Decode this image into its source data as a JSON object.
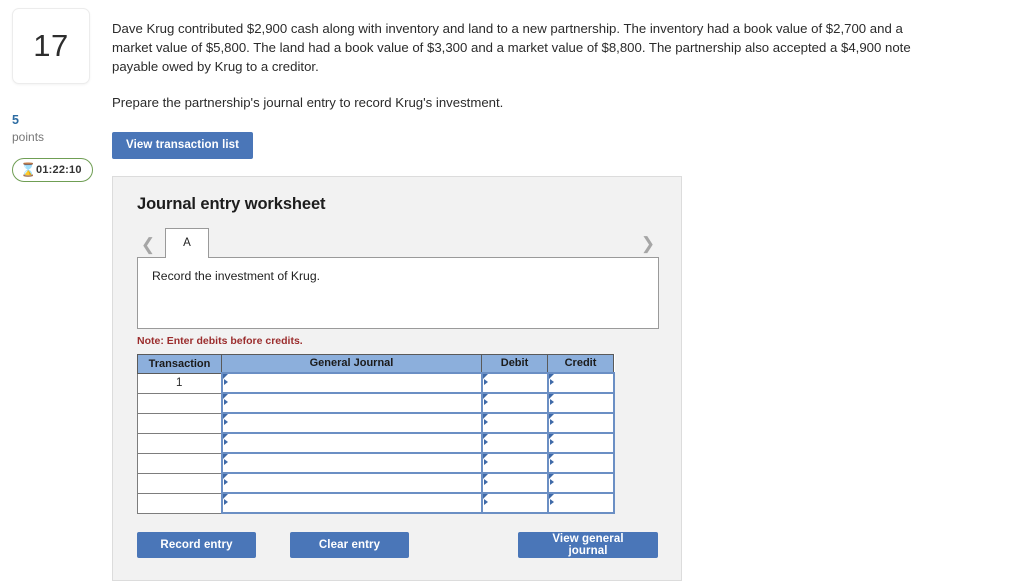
{
  "question": {
    "number": "17",
    "points_value": "5",
    "points_label": "points",
    "timer": "01:22:10",
    "timer_icon": "hourglass-icon",
    "paragraph_1": "Dave Krug contributed $2,900 cash along with inventory and land to a new partnership. The inventory had a book value of $2,700 and a market value of $5,800. The land had a book value of $3,300 and a market value of $8,800. The partnership also accepted a $4,900 note payable owed by Krug to a creditor.",
    "paragraph_2": "Prepare the partnership's journal entry to record Krug's investment.",
    "view_transaction_list_label": "View transaction list"
  },
  "worksheet": {
    "title": "Journal entry worksheet",
    "prev_icon": "chevron-left-icon",
    "next_icon": "chevron-right-icon",
    "tabs": [
      {
        "label": "A",
        "active": true
      }
    ],
    "instruction": "Record the investment of Krug.",
    "note": "Note: Enter debits before credits.",
    "table": {
      "columns": [
        "Transaction",
        "General Journal",
        "Debit",
        "Credit"
      ],
      "rows": [
        {
          "transaction": "1",
          "general_journal": "",
          "debit": "",
          "credit": ""
        },
        {
          "transaction": "",
          "general_journal": "",
          "debit": "",
          "credit": ""
        },
        {
          "transaction": "",
          "general_journal": "",
          "debit": "",
          "credit": ""
        },
        {
          "transaction": "",
          "general_journal": "",
          "debit": "",
          "credit": ""
        },
        {
          "transaction": "",
          "general_journal": "",
          "debit": "",
          "credit": ""
        },
        {
          "transaction": "",
          "general_journal": "",
          "debit": "",
          "credit": ""
        },
        {
          "transaction": "",
          "general_journal": "",
          "debit": "",
          "credit": ""
        }
      ]
    },
    "actions": {
      "record_entry": "Record entry",
      "clear_entry": "Clear entry",
      "view_general_journal": "View general journal"
    }
  },
  "colors": {
    "button_blue": "#4a76b8",
    "table_header_blue": "#8cafdc",
    "cell_border_blue": "#6b8fc4",
    "note_red": "#9b2d2d",
    "timer_green": "#6f9e54",
    "points_blue": "#2d6ca2",
    "panel_gray": "#f2f2f2"
  }
}
